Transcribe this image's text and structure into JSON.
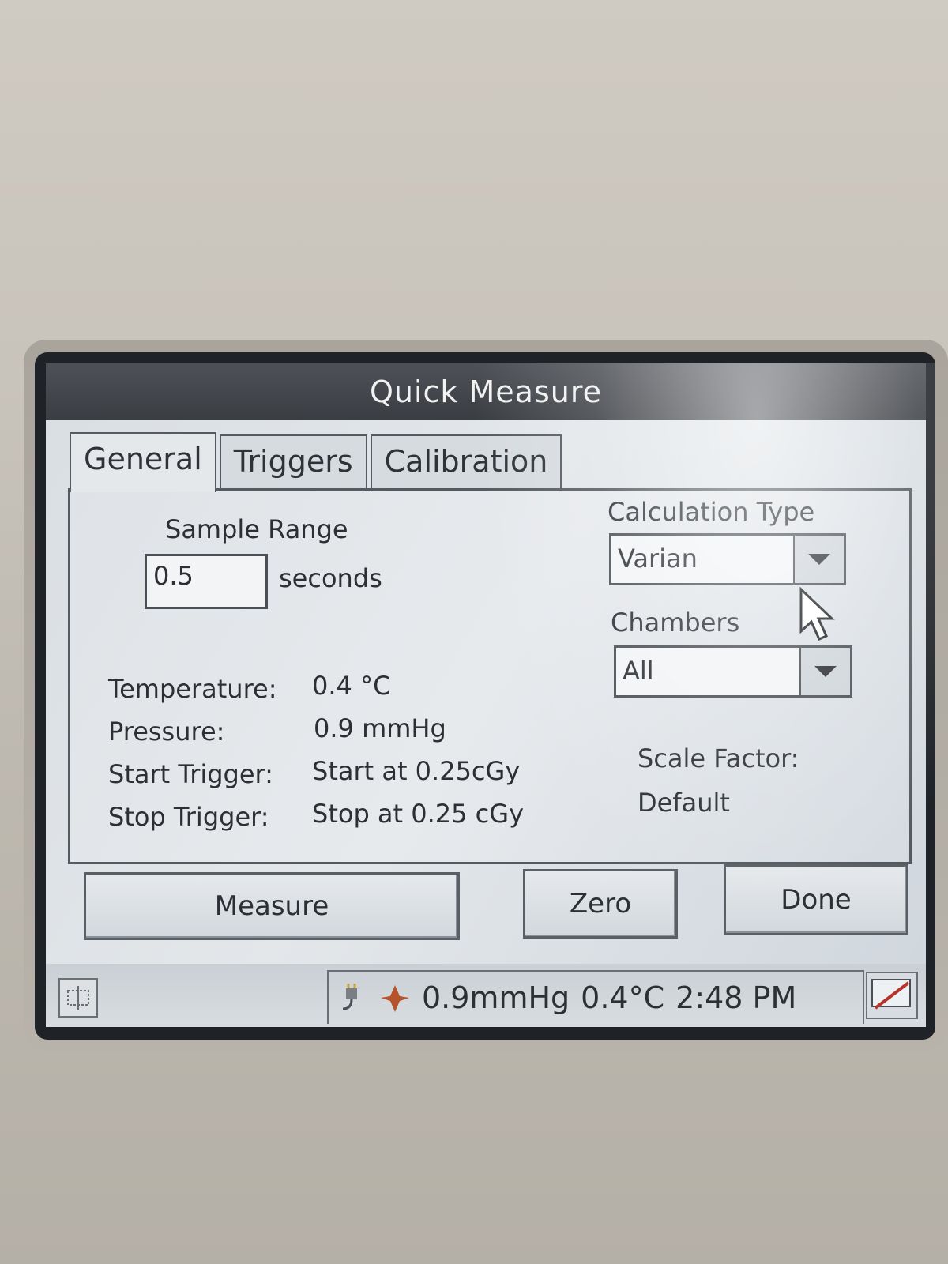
{
  "window": {
    "title": "Quick Measure"
  },
  "tabs": [
    {
      "label": "General"
    },
    {
      "label": "Triggers"
    },
    {
      "label": "Calibration"
    }
  ],
  "general": {
    "sample_range_label": "Sample Range",
    "sample_range_value": "0.5",
    "sample_range_unit": "seconds",
    "calculation_type_label": "Calculation Type",
    "calculation_type_value": "Varian",
    "chambers_label": "Chambers",
    "chambers_value": "All",
    "temperature_label": "Temperature:",
    "temperature_value": "0.4 °C",
    "pressure_label": "Pressure:",
    "pressure_value": "0.9 mmHg",
    "start_trigger_label": "Start Trigger:",
    "start_trigger_value": "Start at 0.25cGy",
    "stop_trigger_label": "Stop Trigger:",
    "stop_trigger_value": "Stop at 0.25 cGy",
    "scale_factor_label": "Scale Factor:",
    "scale_factor_value": "Default"
  },
  "buttons": {
    "measure": "Measure",
    "zero": "Zero",
    "done": "Done"
  },
  "taskbar": {
    "pressure": "0.9mmHg",
    "temperature": "0.4°C",
    "time": "2:48 PM"
  },
  "icons": {
    "start": "start-menu-icon",
    "power": "power-plug-icon",
    "network": "network-icon",
    "desktop": "show-desktop-icon",
    "pointer": "mouse-pointer-icon"
  }
}
